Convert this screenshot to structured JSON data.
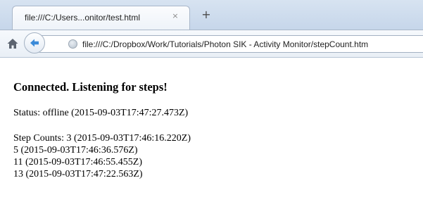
{
  "browser": {
    "tab_title": "file:///C:/Users...onitor/test.html",
    "tab_close_glyph": "×",
    "new_tab_glyph": "+",
    "url": "file:///C:/Dropbox/Work/Tutorials/Photon SIK - Activity Monitor/stepCount.htm",
    "icons": {
      "home": "home-icon",
      "back": "back-arrow-icon",
      "site": "globe-icon",
      "close": "close-icon",
      "new_tab": "plus-icon"
    },
    "colors": {
      "chrome_top": "#d7e3f1",
      "chrome_nav": "#eef3f9",
      "back_arrow": "#3b8ad8"
    }
  },
  "page": {
    "heading": "Connected. Listening for steps!",
    "status": "Status: offline (2015-09-03T17:47:27.473Z)",
    "step_counts": [
      "Step Counts: 3 (2015-09-03T17:46:16.220Z)",
      "5 (2015-09-03T17:46:36.576Z)",
      "11 (2015-09-03T17:46:55.455Z)",
      "13 (2015-09-03T17:47:22.563Z)"
    ]
  }
}
